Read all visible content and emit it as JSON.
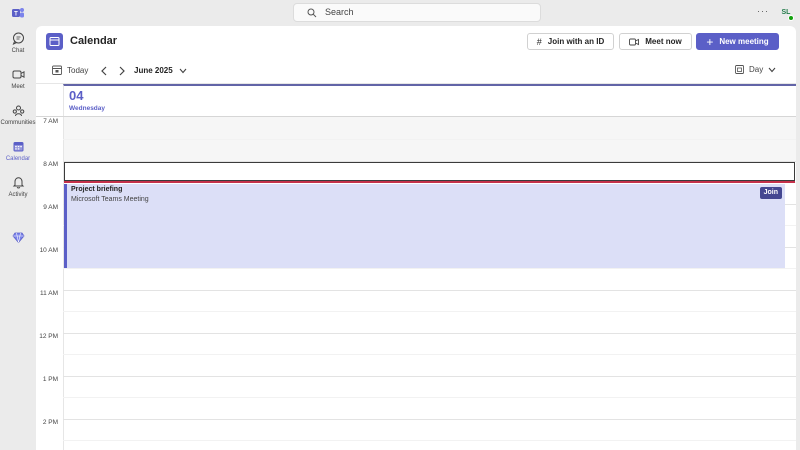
{
  "search": {
    "placeholder": "Search"
  },
  "topbar": {
    "more_label": "···",
    "avatar_initials": "SL"
  },
  "rail": [
    {
      "label": "Chat",
      "icon": "chat-icon"
    },
    {
      "label": "Meet",
      "icon": "video-icon"
    },
    {
      "label": "Communities",
      "icon": "communities-icon"
    },
    {
      "label": "Calendar",
      "icon": "calendar-icon",
      "active": true
    },
    {
      "label": "Activity",
      "icon": "bell-icon"
    }
  ],
  "header": {
    "title": "Calendar",
    "join_with_id": "Join with an ID",
    "meet_now": "Meet now",
    "new_meeting": "New meeting"
  },
  "toolbar": {
    "today": "Today",
    "month": "June 2025",
    "view": "Day"
  },
  "day": {
    "number": "04",
    "name": "Wednesday"
  },
  "times": [
    "7 AM",
    "8 AM",
    "9 AM",
    "10 AM",
    "11 AM",
    "12 PM",
    "1 PM",
    "2 PM"
  ],
  "event": {
    "title": "Project briefing",
    "subtitle": "Microsoft Teams Meeting",
    "join_label": "Join"
  },
  "colors": {
    "accent": "#5b5fc7",
    "event_bg": "#dcdff7",
    "now_line": "#c4314b",
    "join_button": "#444791"
  }
}
